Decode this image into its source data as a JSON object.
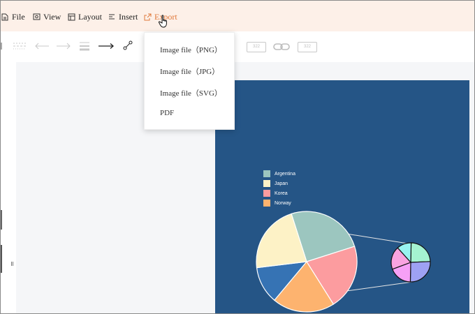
{
  "menu": {
    "file": "File",
    "view": "View",
    "layout": "Layout",
    "insert": "Insert",
    "export": "Export"
  },
  "toolbar": {
    "box1": "322",
    "box2": "322"
  },
  "export_menu": {
    "items": [
      "Image file（PNG）",
      "Image file（JPG）",
      "Image file（SVG）",
      "PDF"
    ]
  },
  "chart_data": {
    "type": "pie",
    "series": [
      {
        "name": "Argentina",
        "color": "#9cc6bf"
      },
      {
        "name": "Japan",
        "color": "#fdf2c6"
      },
      {
        "name": "Korea",
        "color": "#fc9c9f"
      },
      {
        "name": "Norway",
        "color": "#fdb36f"
      }
    ],
    "extra_slice_color": "#3673b4",
    "slice_shares_percent": [
      25,
      21,
      20,
      12,
      22
    ],
    "breakout_slice_shares_percent": [
      24,
      26,
      19,
      19,
      12
    ],
    "breakout_colors": [
      "#a4f3d1",
      "#9ea1f4",
      "#f6a0f6",
      "#f9a3e0",
      "#98f3f0"
    ],
    "background": "#255586"
  }
}
